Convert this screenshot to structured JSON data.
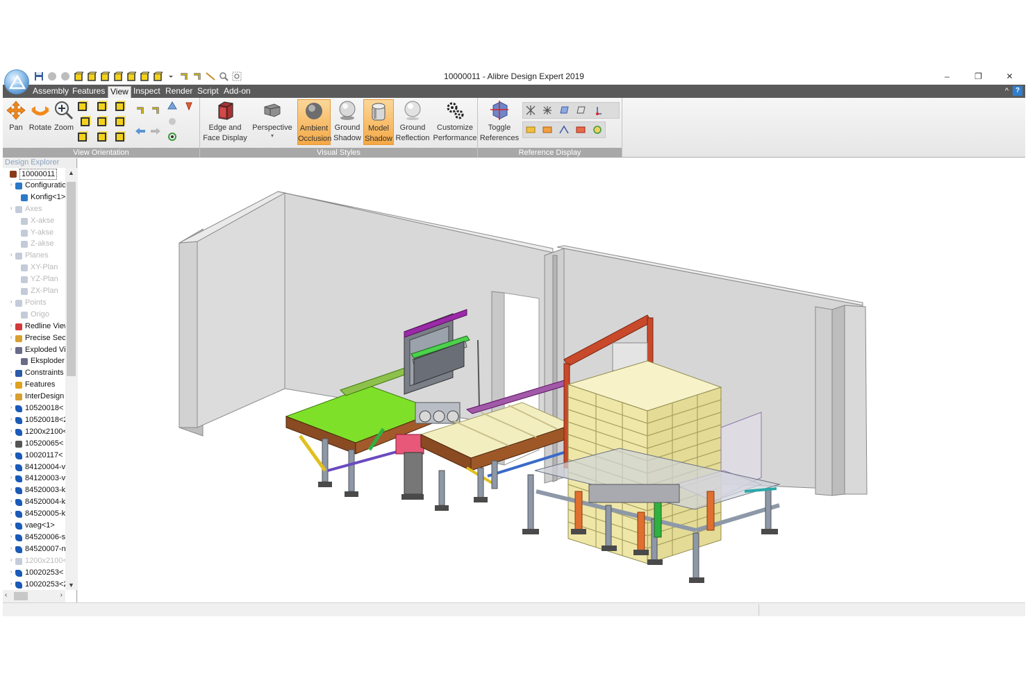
{
  "window": {
    "title": "10000011 - Alibre Design Expert 2019",
    "minimize": "–",
    "restore": "❐",
    "close": "✕"
  },
  "menu": {
    "tabs": [
      "Assembly",
      "Features",
      "View",
      "Inspect",
      "Render",
      "Script",
      "Add-on"
    ],
    "active": "View",
    "collapse": "^",
    "help": "?"
  },
  "ribbon": {
    "view_orientation": {
      "label": "View Orientation",
      "pan": "Pan",
      "rotate": "Rotate",
      "zoom": "Zoom"
    },
    "visual_styles": {
      "label": "Visual Styles",
      "edge_face_1": "Edge and",
      "edge_face_2": "Face Display",
      "perspective": "Perspective",
      "ambient_1": "Ambient",
      "ambient_2": "Occlusion",
      "ground_shadow_1": "Ground",
      "ground_shadow_2": "Shadow",
      "model_shadow_1": "Model",
      "model_shadow_2": "Shadow",
      "ground_reflection_1": "Ground",
      "ground_reflection_2": "Reflection",
      "customize_1": "Customize",
      "customize_2": "Performance"
    },
    "reference_display": {
      "label": "Reference Display",
      "toggle_1": "Toggle",
      "toggle_2": "References"
    }
  },
  "explorer": {
    "title": "Design Explorer",
    "items": [
      {
        "label": "10000011",
        "level": 0,
        "dim": false,
        "icon": "assembly-icon"
      },
      {
        "label": "Configuratio",
        "level": 1,
        "dim": false,
        "icon": "configuration-icon"
      },
      {
        "label": "Konfig<1>",
        "level": 2,
        "dim": false,
        "icon": "configuration-icon"
      },
      {
        "label": "Axes",
        "level": 1,
        "dim": true,
        "icon": "axis-icon"
      },
      {
        "label": "X-akse",
        "level": 2,
        "dim": true,
        "icon": "axis-icon"
      },
      {
        "label": "Y-akse",
        "level": 2,
        "dim": true,
        "icon": "axis-icon"
      },
      {
        "label": "Z-akse",
        "level": 2,
        "dim": true,
        "icon": "axis-icon"
      },
      {
        "label": "Planes",
        "level": 1,
        "dim": true,
        "icon": "plane-icon"
      },
      {
        "label": "XY-Plan",
        "level": 2,
        "dim": true,
        "icon": "plane-icon"
      },
      {
        "label": "YZ-Plan",
        "level": 2,
        "dim": true,
        "icon": "plane-icon"
      },
      {
        "label": "ZX-Plan",
        "level": 2,
        "dim": true,
        "icon": "plane-icon"
      },
      {
        "label": "Points",
        "level": 1,
        "dim": true,
        "icon": "point-icon"
      },
      {
        "label": "Origo",
        "level": 2,
        "dim": true,
        "icon": "point-icon"
      },
      {
        "label": "Redline View",
        "level": 1,
        "dim": false,
        "icon": "redline-icon"
      },
      {
        "label": "Precise Sec",
        "level": 1,
        "dim": false,
        "icon": "section-icon"
      },
      {
        "label": "Exploded Vi",
        "level": 1,
        "dim": false,
        "icon": "exploded-icon"
      },
      {
        "label": "Eksploder",
        "level": 2,
        "dim": false,
        "icon": "exploded-icon"
      },
      {
        "label": "Constraints",
        "level": 1,
        "dim": false,
        "icon": "constraints-icon"
      },
      {
        "label": "Features",
        "level": 1,
        "dim": false,
        "icon": "features-icon"
      },
      {
        "label": "InterDesign",
        "level": 1,
        "dim": false,
        "icon": "interdesign-icon"
      },
      {
        "label": "10520018<",
        "level": 1,
        "dim": false,
        "icon": "part-icon"
      },
      {
        "label": "10520018<2",
        "level": 1,
        "dim": false,
        "icon": "part-icon"
      },
      {
        "label": "1200x2100<",
        "level": 1,
        "dim": false,
        "icon": "part-icon"
      },
      {
        "label": "10520065<",
        "level": 1,
        "dim": false,
        "icon": "subassembly-icon"
      },
      {
        "label": "10020117<",
        "level": 1,
        "dim": false,
        "icon": "part-icon"
      },
      {
        "label": "84120004-v",
        "level": 1,
        "dim": false,
        "icon": "part-icon"
      },
      {
        "label": "84120003-v",
        "level": 1,
        "dim": false,
        "icon": "part-icon"
      },
      {
        "label": "84520003-k",
        "level": 1,
        "dim": false,
        "icon": "part-icon"
      },
      {
        "label": "84520004-k",
        "level": 1,
        "dim": false,
        "icon": "part-icon"
      },
      {
        "label": "84520005-k",
        "level": 1,
        "dim": false,
        "icon": "part-icon"
      },
      {
        "label": "vaeg<1>",
        "level": 1,
        "dim": false,
        "icon": "part-icon"
      },
      {
        "label": "84520006-s",
        "level": 1,
        "dim": false,
        "icon": "part-icon"
      },
      {
        "label": "84520007-n",
        "level": 1,
        "dim": false,
        "icon": "part-icon"
      },
      {
        "label": "1200x2100<",
        "level": 1,
        "dim": true,
        "icon": "subassembly-icon"
      },
      {
        "label": "10020253<",
        "level": 1,
        "dim": false,
        "icon": "part-icon"
      },
      {
        "label": "10020253<2",
        "level": 1,
        "dim": false,
        "icon": "part-icon"
      }
    ]
  },
  "colors": {
    "menubar": "#5a5a5a",
    "ribbon_group_label": "#a8a8a8",
    "active_style": "#f5a844",
    "wall": "#cdcdcd",
    "conveyor_green": "#7fe02a",
    "frame_brown": "#8a4a22",
    "pallet": "#f0eab0"
  }
}
